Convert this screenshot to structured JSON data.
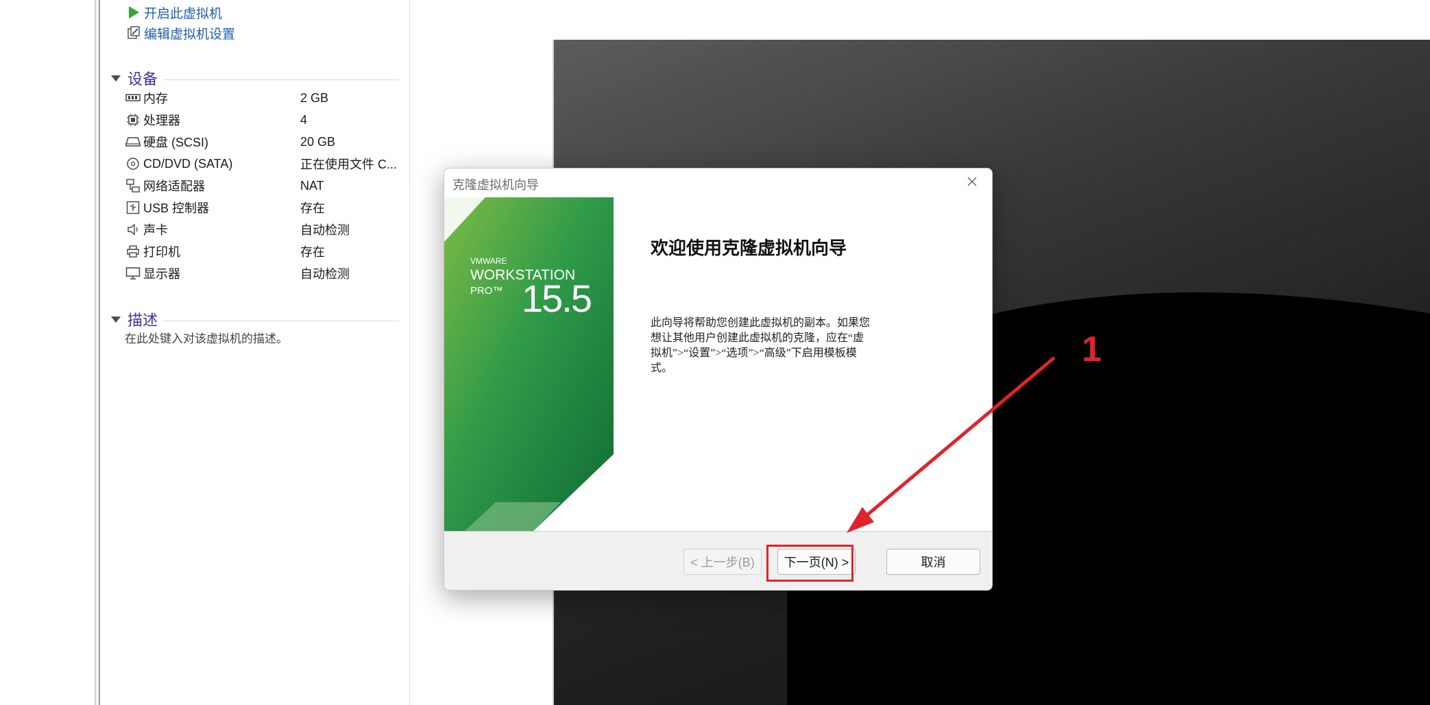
{
  "left_panel": {
    "actions": [
      {
        "label": "开启此虚拟机",
        "icon": "play-icon"
      },
      {
        "label": "编辑虚拟机设置",
        "icon": "edit-settings-icon"
      }
    ],
    "devices_title": "设备",
    "devices": [
      {
        "name": "内存",
        "value": "2 GB",
        "icon": "memory-icon"
      },
      {
        "name": "处理器",
        "value": "4",
        "icon": "processor-icon"
      },
      {
        "name": "硬盘 (SCSI)",
        "value": "20 GB",
        "icon": "hard-disk-icon"
      },
      {
        "name": "CD/DVD (SATA)",
        "value": "正在使用文件 C...",
        "icon": "cd-dvd-icon"
      },
      {
        "name": "网络适配器",
        "value": "NAT",
        "icon": "network-adapter-icon"
      },
      {
        "name": "USB 控制器",
        "value": "存在",
        "icon": "usb-icon"
      },
      {
        "name": "声卡",
        "value": "自动检测",
        "icon": "sound-icon"
      },
      {
        "name": "打印机",
        "value": "存在",
        "icon": "printer-icon"
      },
      {
        "name": "显示器",
        "value": "自动检测",
        "icon": "display-icon"
      }
    ],
    "description_title": "描述",
    "description_placeholder": "在此处键入对该虚拟机的描述。"
  },
  "dialog": {
    "title": "克隆虚拟机向导",
    "banner": {
      "brand": "VMWARE",
      "product": "WORKSTATION",
      "edition": "PRO™",
      "version": "15.5"
    },
    "heading": "欢迎使用克隆虚拟机向导",
    "body": "此向导将帮助您创建此虚拟机的副本。如果您想让其他用户创建此虚拟机的克隆，应在“虚拟机”>“设置”>“选项”>“高级”下启用模板模式。",
    "buttons": {
      "back": "< 上一步(B)",
      "next": "下一页(N) >",
      "cancel": "取消"
    }
  },
  "annotation": {
    "number": "1",
    "color": "#e0232c"
  },
  "colors": {
    "link": "#1f5fae",
    "section_title": "#3a3596",
    "banner_green": "#2e8b45"
  }
}
